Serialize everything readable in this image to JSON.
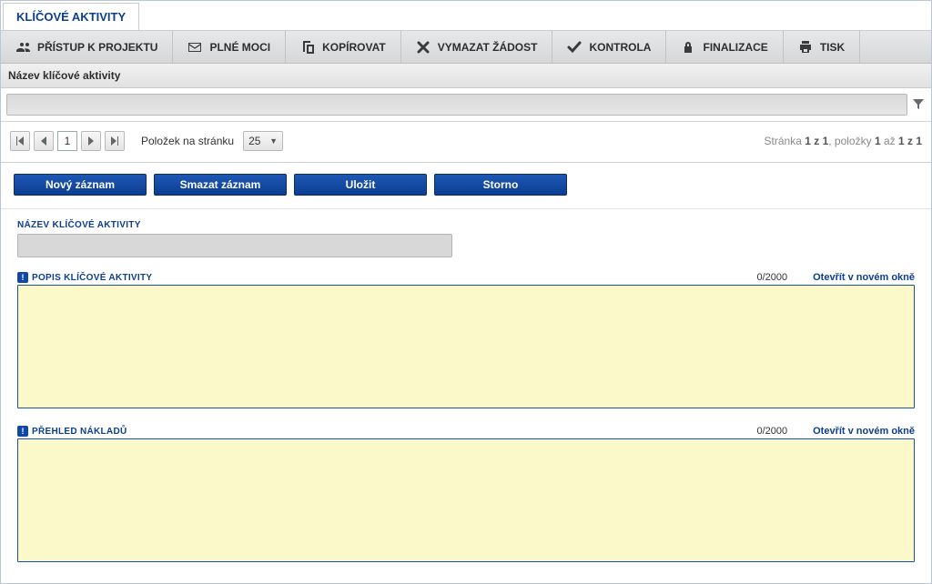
{
  "tab": {
    "title": "KLÍČOVÉ AKTIVITY"
  },
  "toolbar": {
    "access": "PŘÍSTUP K PROJEKTU",
    "powers": "PLNÉ MOCI",
    "copy": "KOPÍROVAT",
    "delete": "VYMAZAT ŽÁDOST",
    "check": "KONTROLA",
    "finalize": "FINALIZACE",
    "print": "TISK"
  },
  "grid": {
    "column_header": "Název klíčové aktivity"
  },
  "pager": {
    "page": "1",
    "items_label": "Položek na stránku",
    "per_page": "25",
    "summary_prefix": "Stránka ",
    "summary_page": "1 z 1",
    "summary_mid": ", položky ",
    "summary_from": "1",
    "summary_to_word": " až ",
    "summary_to": "1 z 1"
  },
  "actions": {
    "new": "Nový záznam",
    "delete": "Smazat záznam",
    "save": "Uložit",
    "cancel": "Storno"
  },
  "form": {
    "name_label": "NÁZEV KLÍČOVÉ AKTIVITY",
    "desc_label": "POPIS KLÍČOVÉ AKTIVITY",
    "desc_counter": "0/2000",
    "costs_label": "PŘEHLED NÁKLADŮ",
    "costs_counter": "0/2000",
    "open_new": "Otevřít v novém okně"
  }
}
